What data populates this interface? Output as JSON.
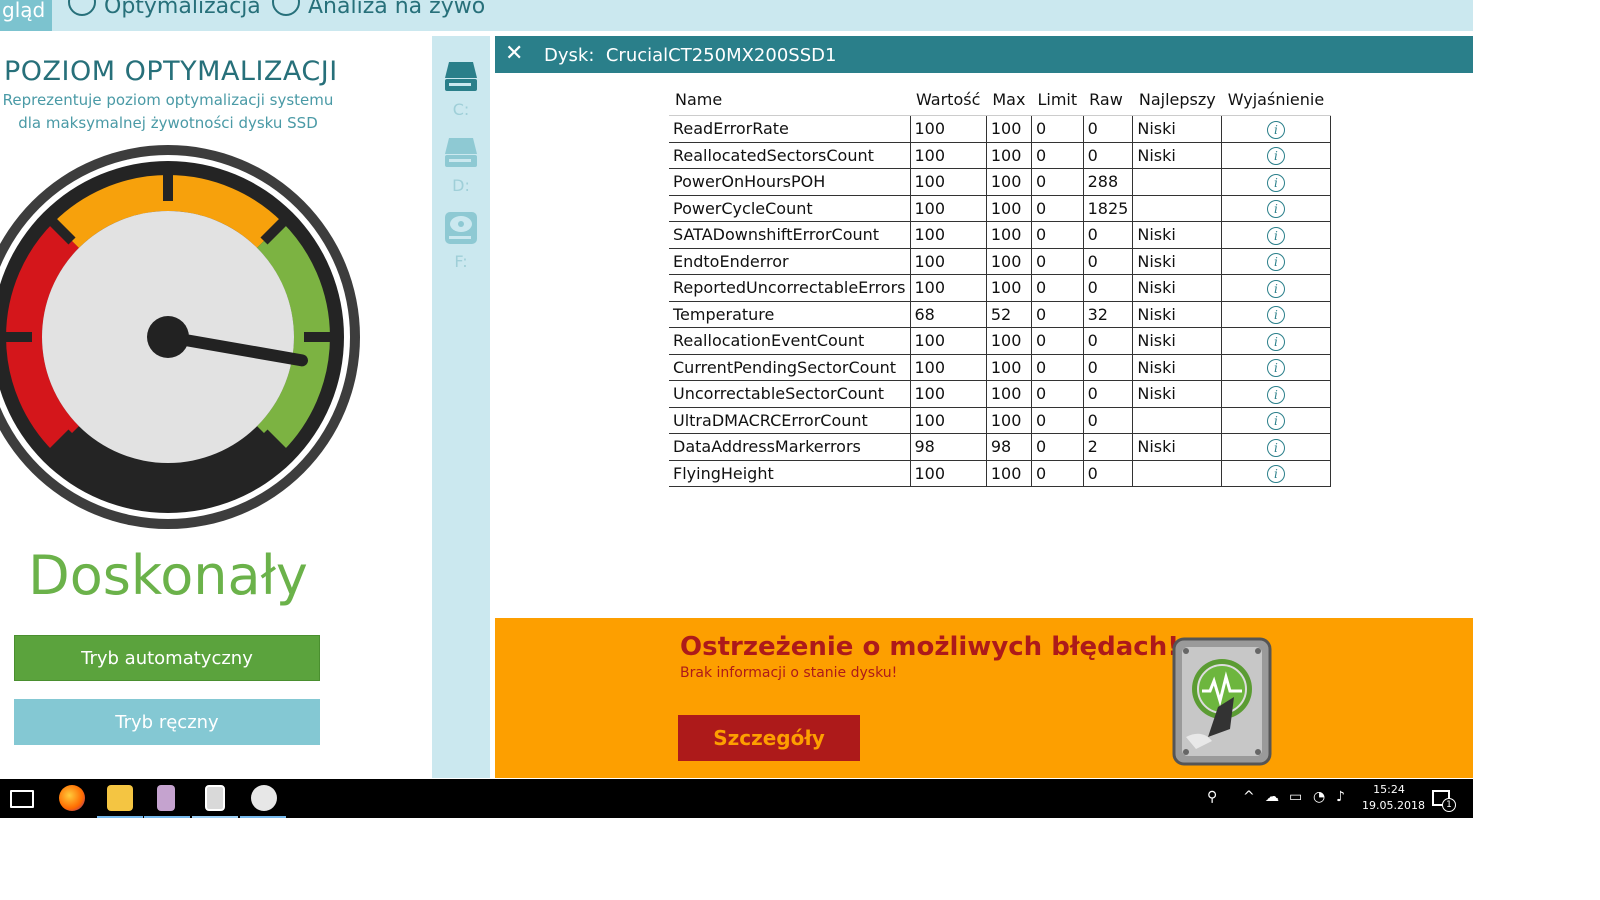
{
  "topnav": {
    "active_tab": "gląd",
    "tabs": [
      {
        "label": "Optymalizacja",
        "icon": "speedometer-icon"
      },
      {
        "label": "Analiza na żywo",
        "icon": "pen-icon"
      }
    ]
  },
  "left": {
    "title": "POZIOM OPTYMALIZACJI",
    "subtitle_line1": "Reprezentuje poziom optymalizacji systemu",
    "subtitle_line2": "dla maksymalnej żywotności dysku SSD",
    "gauge_level": 0.87,
    "status": "Doskonały",
    "btn_auto": "Tryb automatyczny",
    "btn_manual": "Tryb ręczny"
  },
  "drives": [
    {
      "label": "C:",
      "icon": "ssd-drive-icon"
    },
    {
      "label": "D:",
      "icon": "ssd-drive-icon"
    },
    {
      "label": "F:",
      "icon": "hdd-drive-icon"
    }
  ],
  "panel": {
    "title_label": "Dysk:",
    "disk_name": "CrucialCT250MX200SSD1",
    "close_icon": "close-icon"
  },
  "table": {
    "headers": [
      "Name",
      "Wartość",
      "Max",
      "Limit",
      "Raw",
      "Najlepszy",
      "Wyjaśnienie"
    ],
    "rows": [
      {
        "name": "ReadErrorRate",
        "value": "100",
        "max": "100",
        "limit": "0",
        "raw": "0",
        "best": "Niski"
      },
      {
        "name": "ReallocatedSectorsCount",
        "value": "100",
        "max": "100",
        "limit": "0",
        "raw": "0",
        "best": "Niski"
      },
      {
        "name": "PowerOnHoursPOH",
        "value": "100",
        "max": "100",
        "limit": "0",
        "raw": "288",
        "best": ""
      },
      {
        "name": "PowerCycleCount",
        "value": "100",
        "max": "100",
        "limit": "0",
        "raw": "1825",
        "best": ""
      },
      {
        "name": "SATADownshiftErrorCount",
        "value": "100",
        "max": "100",
        "limit": "0",
        "raw": "0",
        "best": "Niski"
      },
      {
        "name": "EndtoEnderror",
        "value": "100",
        "max": "100",
        "limit": "0",
        "raw": "0",
        "best": "Niski"
      },
      {
        "name": "ReportedUncorrectableErrors",
        "value": "100",
        "max": "100",
        "limit": "0",
        "raw": "0",
        "best": "Niski"
      },
      {
        "name": "Temperature",
        "value": "68",
        "max": "52",
        "limit": "0",
        "raw": "32",
        "best": "Niski"
      },
      {
        "name": "ReallocationEventCount",
        "value": "100",
        "max": "100",
        "limit": "0",
        "raw": "0",
        "best": "Niski"
      },
      {
        "name": "CurrentPendingSectorCount",
        "value": "100",
        "max": "100",
        "limit": "0",
        "raw": "0",
        "best": "Niski"
      },
      {
        "name": "UncorrectableSectorCount",
        "value": "100",
        "max": "100",
        "limit": "0",
        "raw": "0",
        "best": "Niski"
      },
      {
        "name": "UltraDMACRCErrorCount",
        "value": "100",
        "max": "100",
        "limit": "0",
        "raw": "0",
        "best": ""
      },
      {
        "name": "DataAddressMarkerrors",
        "value": "98",
        "max": "98",
        "limit": "0",
        "raw": "2",
        "best": "Niski"
      },
      {
        "name": "FlyingHeight",
        "value": "100",
        "max": "100",
        "limit": "0",
        "raw": "0",
        "best": ""
      }
    ],
    "info_icon": "info-icon"
  },
  "warning": {
    "title": "Ostrzeżenie o możliwych błędach!",
    "subtitle": "Brak informacji o stanie dysku!",
    "button": "Szczegóły",
    "icon": "disk-health-icon"
  },
  "taskbar": {
    "apps": [
      "task-view-icon",
      "firefox-icon",
      "file-explorer-icon",
      "app-icon",
      "ssd-tool-icon",
      "paint-icon"
    ],
    "time": "15:24",
    "date": "19.05.2018",
    "notifications": "1"
  },
  "colors": {
    "teal_dark": "#2a7f8a",
    "teal_light": "#cbe8ef",
    "green": "#6bb24a",
    "orange": "#fd9f00",
    "red": "#ad1a1a"
  }
}
